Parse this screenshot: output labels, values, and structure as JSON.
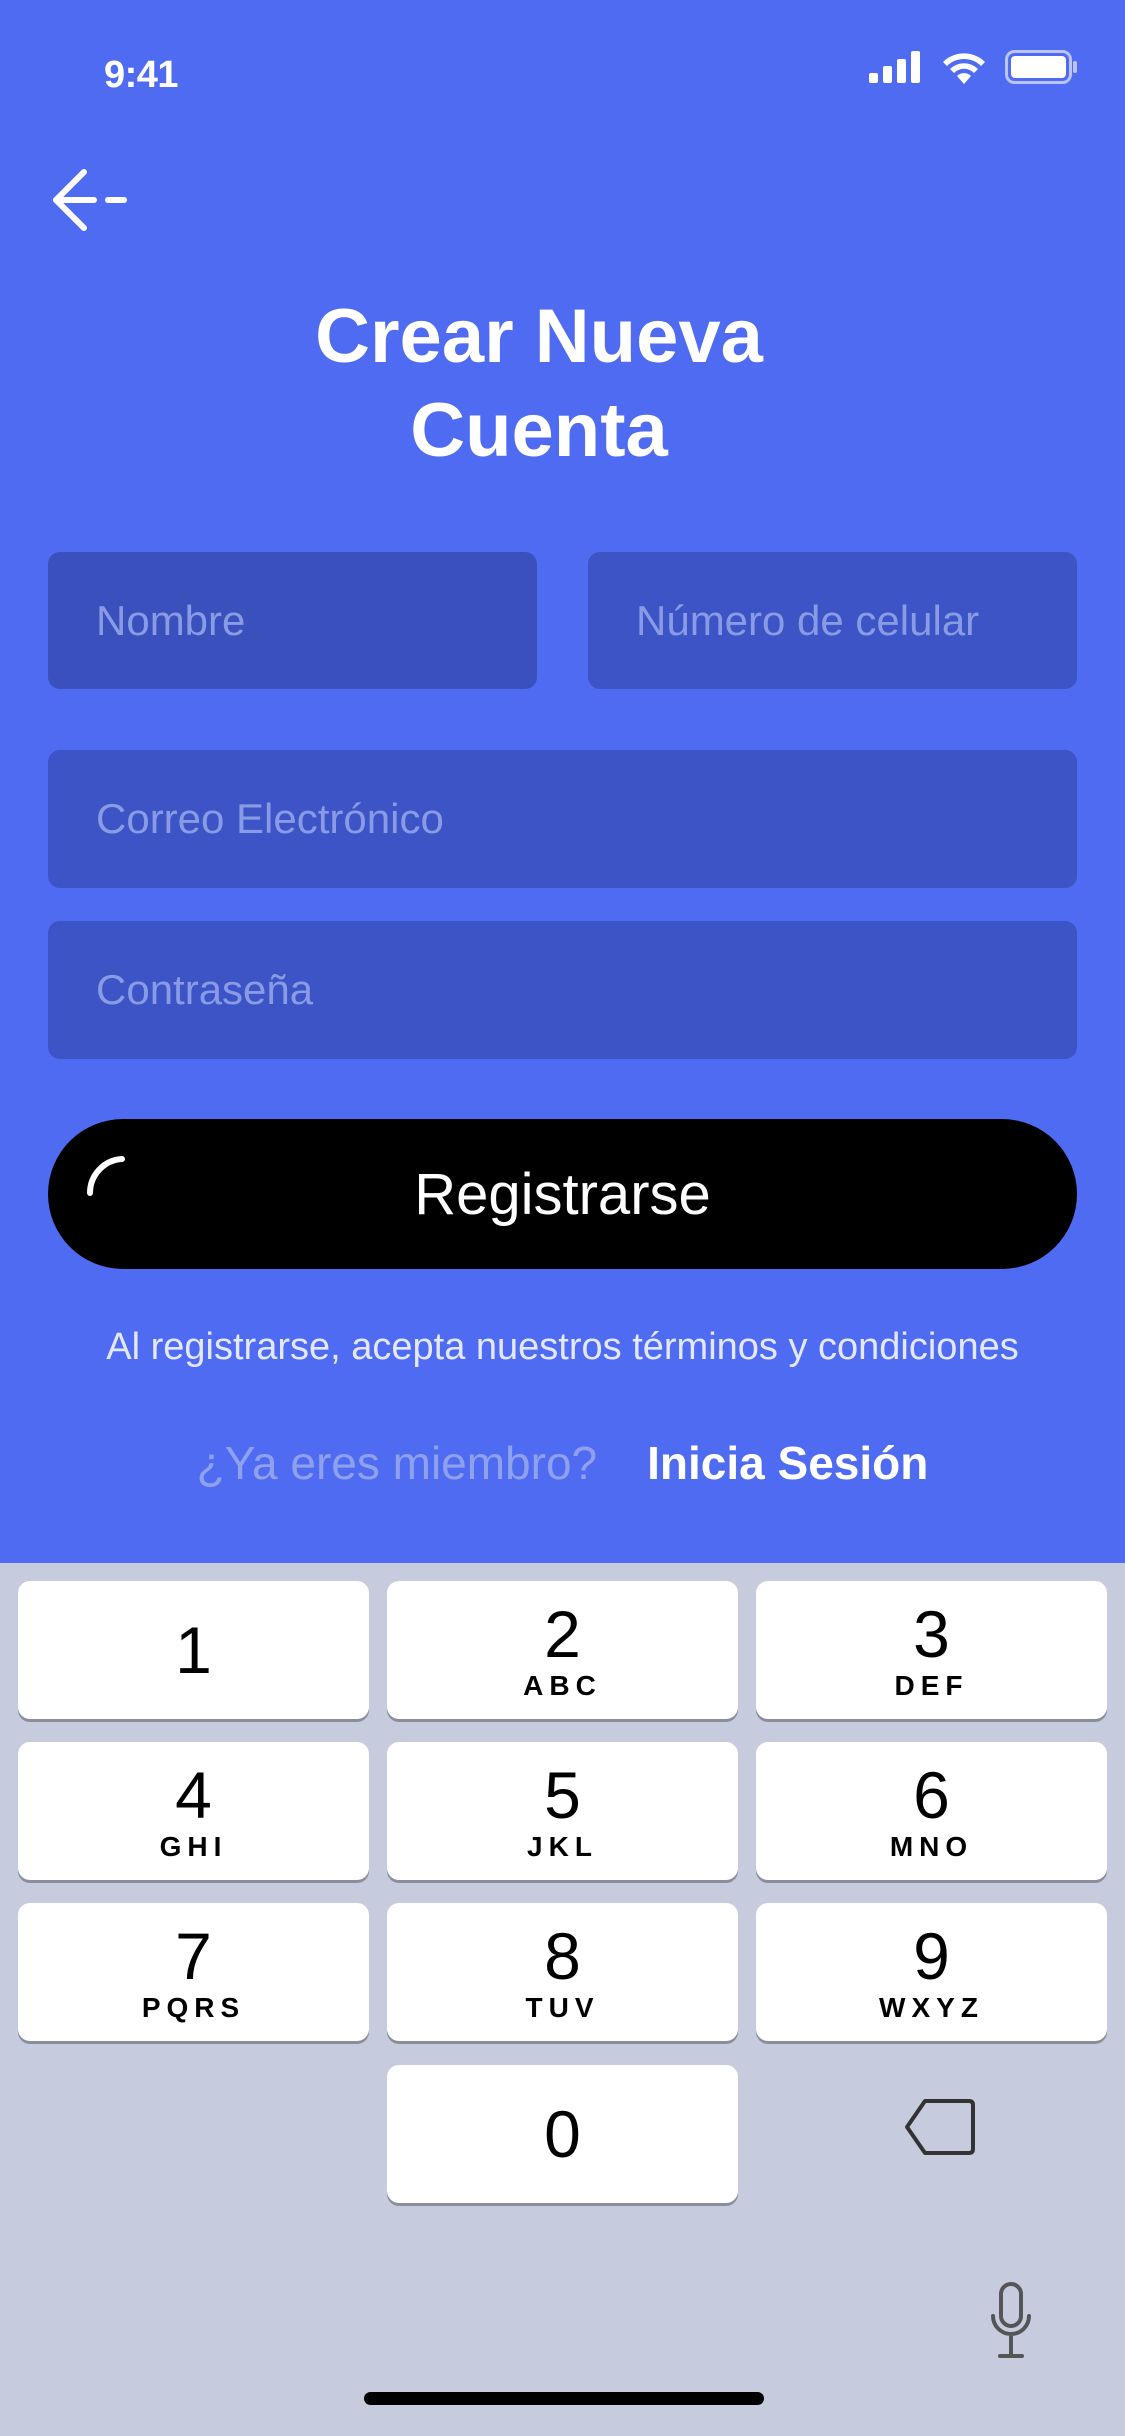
{
  "status": {
    "time": "9:41"
  },
  "header": {
    "title_line1": "Crear Nueva",
    "title_line2": "Cuenta"
  },
  "form": {
    "nombre_placeholder": "Nombre",
    "celular_placeholder": "Número de celular",
    "correo_placeholder": "Correo Electrónico",
    "password_placeholder": "Contraseña",
    "nombre_value": "",
    "celular_value": "",
    "correo_value": "",
    "password_value": ""
  },
  "actions": {
    "register_label": "Registrarse",
    "terms_text": "Al registrarse, acepta nuestros términos y condiciones",
    "member_question": "¿Ya eres miembro?",
    "login_link": "Inicia Sesión"
  },
  "keyboard": {
    "keys": [
      {
        "digit": "1",
        "letters": ""
      },
      {
        "digit": "2",
        "letters": "ABC"
      },
      {
        "digit": "3",
        "letters": "DEF"
      },
      {
        "digit": "4",
        "letters": "GHI"
      },
      {
        "digit": "5",
        "letters": "JKL"
      },
      {
        "digit": "6",
        "letters": "MNO"
      },
      {
        "digit": "7",
        "letters": "PQRS"
      },
      {
        "digit": "8",
        "letters": "TUV"
      },
      {
        "digit": "9",
        "letters": "WXYZ"
      },
      {
        "digit": "0",
        "letters": ""
      }
    ]
  },
  "colors": {
    "background": "#4F6BF2",
    "field": "#3C54C6",
    "button": "#000000",
    "keyboard": "#C6CBDE"
  }
}
